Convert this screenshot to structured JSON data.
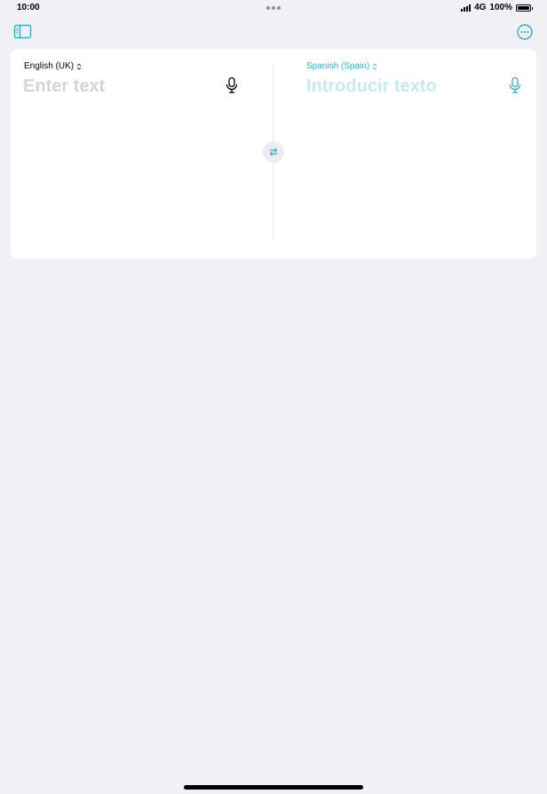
{
  "status_bar": {
    "time": "10:00",
    "network": "4G",
    "battery_percent": "100%"
  },
  "toolbar": {
    "sidebar_icon": "sidebar-icon",
    "more_icon": "ellipsis-circle-icon"
  },
  "source": {
    "language": "English (UK)",
    "placeholder": "Enter text",
    "value": ""
  },
  "target": {
    "language": "Spanish (Spain)",
    "placeholder": "Introducir texto",
    "value": ""
  },
  "colors": {
    "accent": "#30b0c7",
    "background": "#f0f0f5",
    "card": "#ffffff"
  }
}
